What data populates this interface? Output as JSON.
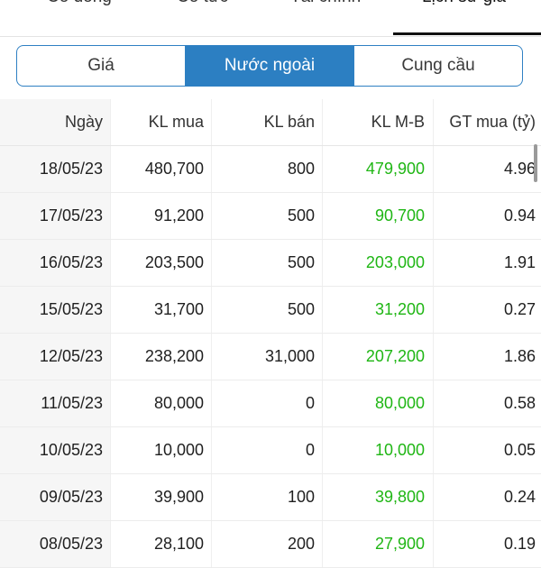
{
  "top_tabs": [
    {
      "label": "Cổ đông"
    },
    {
      "label": "Cổ tức"
    },
    {
      "label": "Tài chính"
    },
    {
      "label": "Lịch sử giá"
    }
  ],
  "segments": [
    {
      "label": "Giá",
      "active": false
    },
    {
      "label": "Nước ngoài",
      "active": true
    },
    {
      "label": "Cung cầu",
      "active": false
    }
  ],
  "table": {
    "headers": [
      "Ngày",
      "KL mua",
      "KL bán",
      "KL M-B",
      "GT mua (tỷ)"
    ],
    "rows": [
      {
        "date": "18/05/23",
        "buy": "480,700",
        "sell": "800",
        "net": "479,900",
        "value": "4.96"
      },
      {
        "date": "17/05/23",
        "buy": "91,200",
        "sell": "500",
        "net": "90,700",
        "value": "0.94"
      },
      {
        "date": "16/05/23",
        "buy": "203,500",
        "sell": "500",
        "net": "203,000",
        "value": "1.91"
      },
      {
        "date": "15/05/23",
        "buy": "31,700",
        "sell": "500",
        "net": "31,200",
        "value": "0.27"
      },
      {
        "date": "12/05/23",
        "buy": "238,200",
        "sell": "31,000",
        "net": "207,200",
        "value": "1.86"
      },
      {
        "date": "11/05/23",
        "buy": "80,000",
        "sell": "0",
        "net": "80,000",
        "value": "0.58"
      },
      {
        "date": "10/05/23",
        "buy": "10,000",
        "sell": "0",
        "net": "10,000",
        "value": "0.05"
      },
      {
        "date": "09/05/23",
        "buy": "39,900",
        "sell": "100",
        "net": "39,800",
        "value": "0.24"
      },
      {
        "date": "08/05/23",
        "buy": "28,100",
        "sell": "200",
        "net": "27,900",
        "value": "0.19"
      }
    ]
  },
  "colors": {
    "accent": "#2c7fc2",
    "positive": "#1fb614"
  }
}
